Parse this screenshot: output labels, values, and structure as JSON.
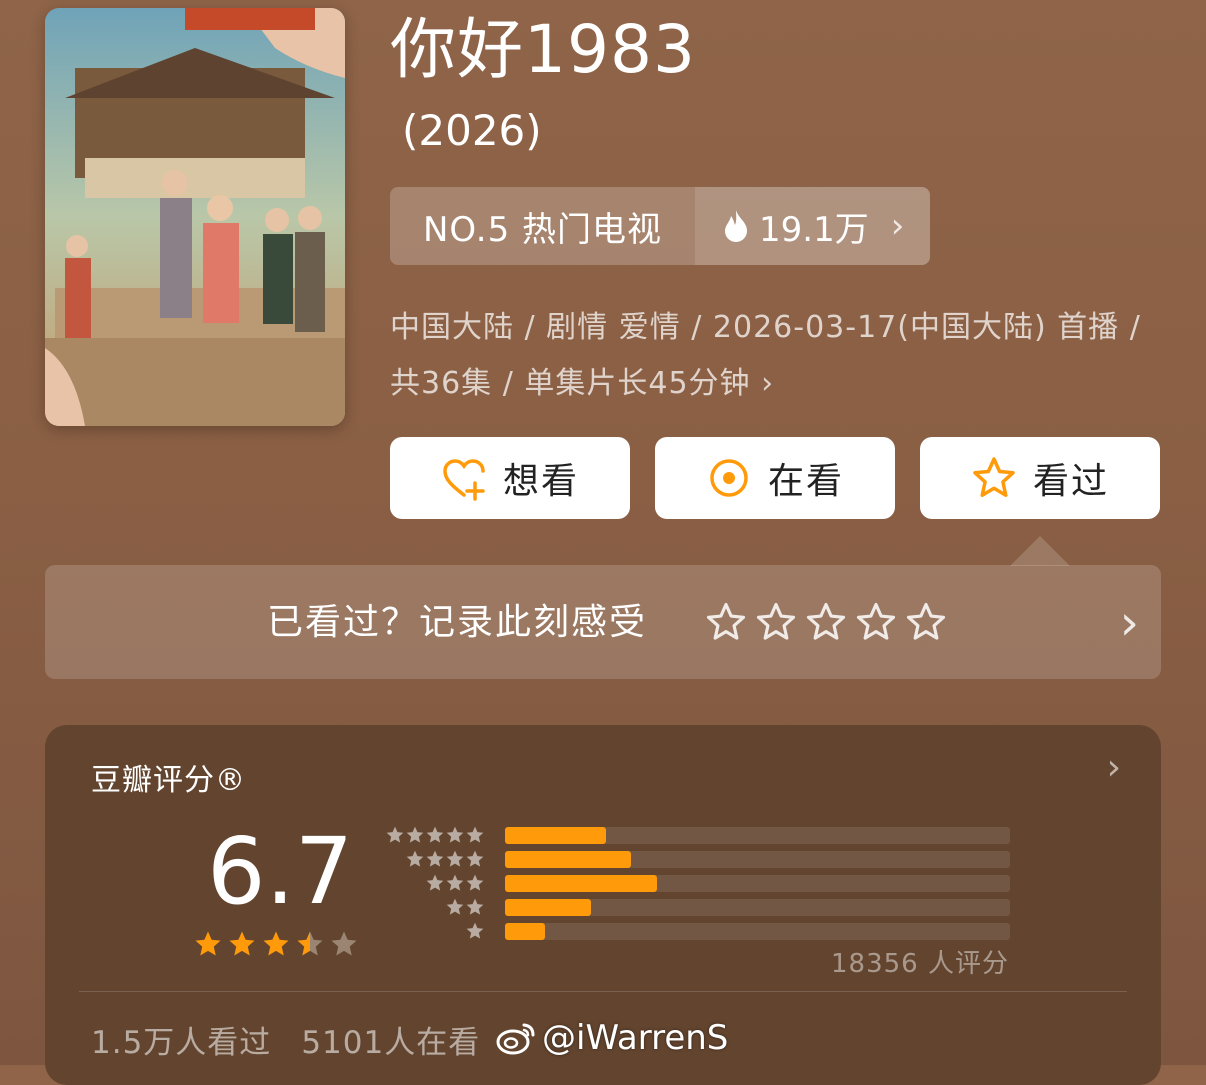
{
  "poster": {
    "alt": "你好1983 poster"
  },
  "title": "你好1983",
  "year": "(2026)",
  "ranking": {
    "label": "NO.5 热门电视",
    "heat": "19.1万"
  },
  "meta": {
    "line1": "中国大陆 / 剧情 爱情 / 2026-03-17(中国大陆) 首播 /",
    "line2": "共36集 / 单集片长45分钟"
  },
  "actions": {
    "want": "想看",
    "watching": "在看",
    "watched": "看过"
  },
  "prompt": {
    "text": "已看过？记录此刻感受",
    "stars": 5
  },
  "rating": {
    "title": "豆瓣评分®",
    "score": "6.7",
    "score_stars": 3.5,
    "histogram": [
      {
        "stars": 5,
        "percent": 20
      },
      {
        "stars": 4,
        "percent": 25
      },
      {
        "stars": 3,
        "percent": 30
      },
      {
        "stars": 2,
        "percent": 17
      },
      {
        "stars": 1,
        "percent": 8
      }
    ],
    "count": "18356 人评分",
    "watched": "1.5万人看过",
    "watching": "5101人在看"
  },
  "watermark": "@iWarrenS",
  "colors": {
    "accent": "#ff9a0a",
    "background": "#8f6448",
    "card": "#63452f"
  }
}
